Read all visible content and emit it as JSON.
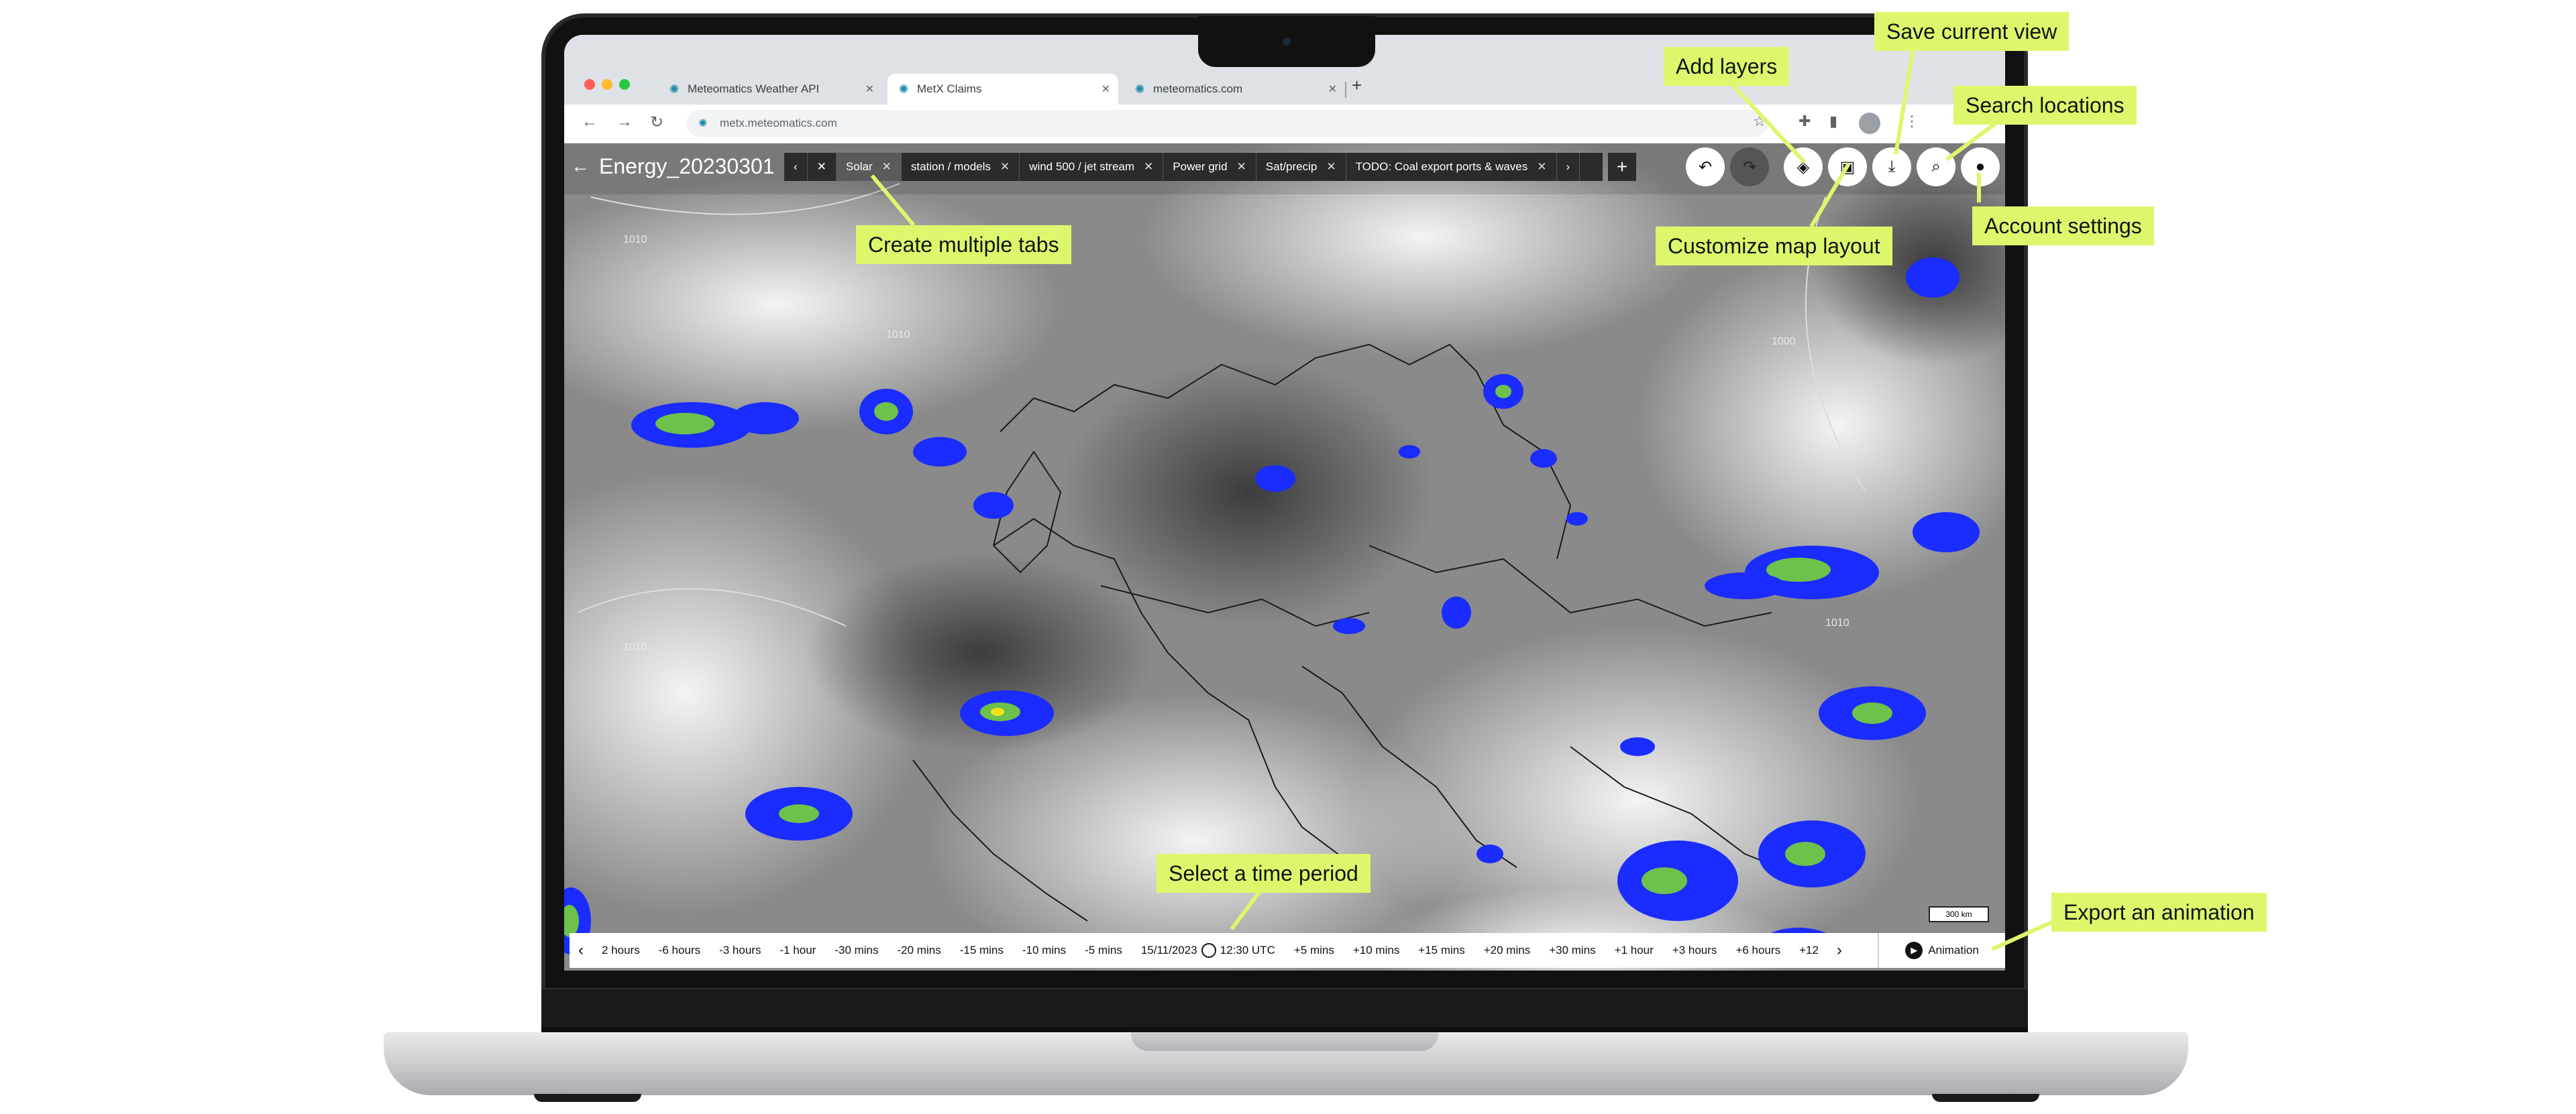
{
  "browser": {
    "tabs": [
      {
        "label": "Meteomatics Weather API",
        "active": false
      },
      {
        "label": "MetX Claims",
        "active": true
      },
      {
        "label": "meteomatics.com",
        "active": false
      }
    ],
    "url": "metx.meteomatics.com"
  },
  "app": {
    "project_title": "Energy_20230301",
    "map_tabs": [
      {
        "label": "Solar",
        "active": true
      },
      {
        "label": "station / models",
        "active": false
      },
      {
        "label": "wind 500 / jet stream",
        "active": false
      },
      {
        "label": "Power grid",
        "active": false
      },
      {
        "label": "Sat/precip",
        "active": false
      },
      {
        "label": "TODO: Coal export ports & waves",
        "active": false
      }
    ],
    "scale_label": "300 km",
    "isobar_labels": [
      "1010",
      "1010",
      "1010",
      "1010",
      "1000"
    ],
    "timeline": {
      "before": [
        "2 hours",
        "-6 hours",
        "-3 hours",
        "-1 hour",
        "-30 mins",
        "-20 mins",
        "-15 mins",
        "-10 mins",
        "-5 mins"
      ],
      "current_date": "15/11/2023",
      "current_time": "12:30 UTC",
      "after": [
        "+5 mins",
        "+10 mins",
        "+15 mins",
        "+20 mins",
        "+30 mins",
        "+1 hour",
        "+3 hours",
        "+6 hours",
        "+12"
      ]
    },
    "animation_label": "Animation",
    "colors": {
      "precip_blue": "#1a2cff",
      "precip_green": "#6cc24a",
      "precip_yellow": "#f2e21e",
      "callout": "#dcf76c"
    }
  },
  "callouts": {
    "add_layers": "Add layers",
    "save_view": "Save current view",
    "search_locations": "Search locations",
    "account_settings": "Account settings",
    "create_tabs": "Create multiple tabs",
    "customize_layout": "Customize map layout",
    "select_time": "Select a time period",
    "export_animation": "Export an animation"
  }
}
